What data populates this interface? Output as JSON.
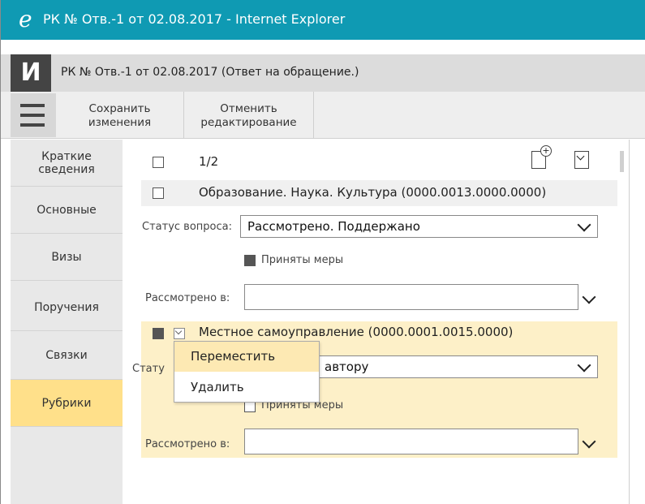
{
  "window": {
    "title": "РК № Отв.-1 от 02.08.2017 - Internet Explorer",
    "browser_icon": "e"
  },
  "app": {
    "logo": "И",
    "doc_title": "РК № Отв.-1 от 02.08.2017 (Ответ на обращение.)"
  },
  "toolbar": {
    "save_line1": "Сохранить",
    "save_line2": "изменения",
    "cancel_line1": "Отменить",
    "cancel_line2": "редактирование"
  },
  "nav": {
    "items": [
      {
        "label_line1": "Краткие",
        "label_line2": "сведения"
      },
      {
        "label_line1": "Основные",
        "label_line2": ""
      },
      {
        "label_line1": "Визы",
        "label_line2": ""
      },
      {
        "label_line1": "Поручения",
        "label_line2": ""
      },
      {
        "label_line1": "Связки",
        "label_line2": ""
      },
      {
        "label_line1": "Рубрики",
        "label_line2": ""
      }
    ],
    "active_index": 5
  },
  "rubrics": {
    "counter": "1/2",
    "items": [
      {
        "title": "Образование. Наука. Культура (0000.0013.0000.0000)",
        "status_label": "Статус вопроса:",
        "status_value": "Рассмотрено. Поддержано",
        "measures_label": "Приняты меры",
        "reviewed_label": "Рассмотрено в:",
        "reviewed_value": ""
      },
      {
        "title": "Местное самоуправление (0000.0001.0015.0000)",
        "status_label": "Стату",
        "status_value": "автору",
        "measures_label": "Приняты меры",
        "reviewed_label": "Рассмотрено в:",
        "reviewed_value": ""
      }
    ]
  },
  "context_menu": {
    "items": [
      "Переместить",
      "Удалить"
    ],
    "highlighted_index": 0
  },
  "colors": {
    "titlebar": "#0f9ab3",
    "active_nav": "#ffe08a",
    "selected_section": "#fdf0c8",
    "menu_highlight": "#fde9b3"
  }
}
